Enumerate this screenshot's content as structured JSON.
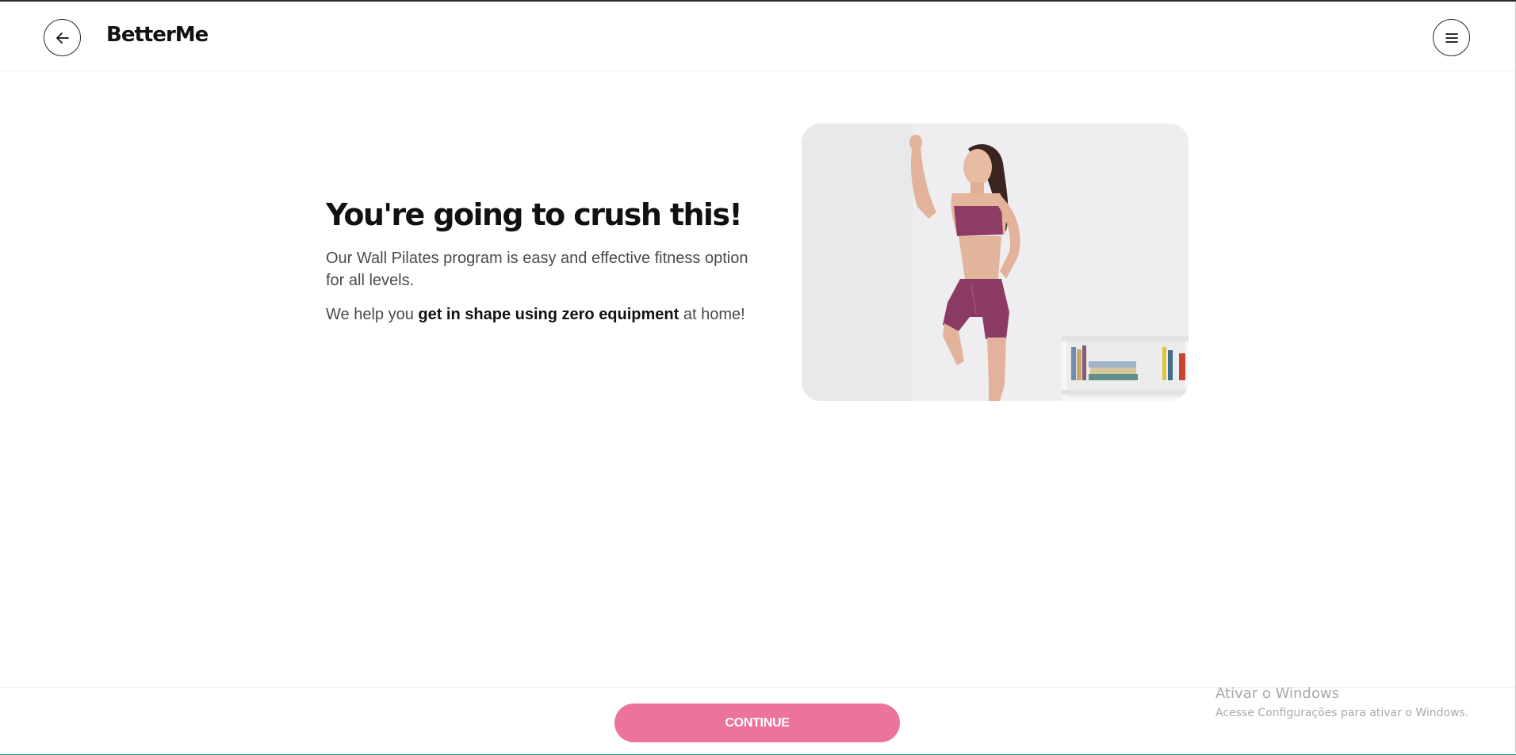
{
  "header": {
    "back_icon": "arrow-left-icon",
    "logo": "BetterMe",
    "menu_icon": "hamburger-menu-icon"
  },
  "main": {
    "headline": "You're going to crush this!",
    "paragraph1": "Our Wall Pilates program is easy and effective fitness option for all levels.",
    "paragraph2": {
      "before": "We help you ",
      "bold": "get in shape using zero equipment",
      "after": " at home!"
    },
    "image_subject": "woman in purple workout outfit leaning against wall"
  },
  "footer": {
    "continue_label": "CONTINUE",
    "accent_color": "#ec7399"
  },
  "system_overlay": {
    "title": "Ativar o Windows",
    "subtitle": "Acesse Configurações para ativar o Windows."
  }
}
